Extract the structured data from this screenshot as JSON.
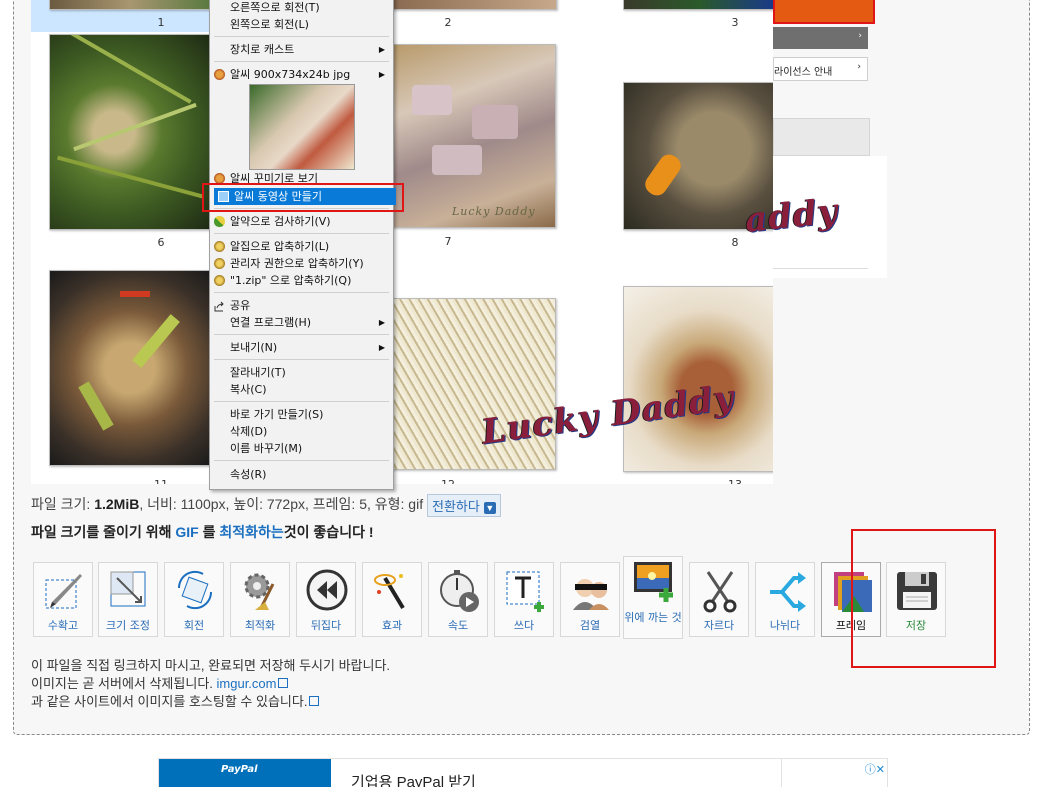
{
  "thumbnails": [
    {
      "label": "1"
    },
    {
      "label": "2"
    },
    {
      "label": "3"
    },
    {
      "label": "6"
    },
    {
      "label": "7"
    },
    {
      "label": "8"
    },
    {
      "label": "11"
    },
    {
      "label": "12"
    },
    {
      "label": "13"
    }
  ],
  "watermark_text": "Lucky Daddy",
  "right_panel": {
    "license_label": "라이선스 안내"
  },
  "context_menu": {
    "items": [
      {
        "label": "오른쪽으로 회전(T)"
      },
      {
        "label": "왼쪽으로 회전(L)"
      },
      {
        "label": "장치로 캐스트",
        "submenu": true
      },
      {
        "label": "알씨 900x734x24b jpg",
        "submenu": true
      },
      {
        "label": "알씨 꾸미기로 보기"
      },
      {
        "label": "알씨 동영상 만들기"
      },
      {
        "label": "알약으로 검사하기(V)"
      },
      {
        "label": "알집으로 압축하기(L)"
      },
      {
        "label": "관리자 권한으로 압축하기(Y)"
      },
      {
        "label": "\"1.zip\" 으로 압축하기(Q)"
      },
      {
        "label": "공유"
      },
      {
        "label": "연결 프로그램(H)",
        "submenu": true
      },
      {
        "label": "보내기(N)",
        "submenu": true
      },
      {
        "label": "잘라내기(T)"
      },
      {
        "label": "복사(C)"
      },
      {
        "label": "바로 가기 만들기(S)"
      },
      {
        "label": "삭제(D)"
      },
      {
        "label": "이름 바꾸기(M)"
      },
      {
        "label": "속성(R)"
      }
    ],
    "highlighted_index": 5
  },
  "file_info": {
    "size_prefix": "파일 크기:",
    "size_value": "1.2MiB",
    "rest": ", 너비: 1100px, 높이: 772px, 프레임: 5, 유형: gif",
    "convert_label": "전환하다"
  },
  "advice": {
    "part1": "파일 크기를 줄이기 위해",
    "gif": "GIF",
    "part2": "를",
    "optimize": "최적화하는",
    "part3": "것이 좋습니다 !"
  },
  "tools": [
    {
      "label": "수확고"
    },
    {
      "label": "크기 조정"
    },
    {
      "label": "회전"
    },
    {
      "label": "최적화"
    },
    {
      "label": "뒤집다"
    },
    {
      "label": "효과"
    },
    {
      "label": "속도"
    },
    {
      "label": "쓰다"
    },
    {
      "label": "검열"
    },
    {
      "label": "위에 까는 것"
    },
    {
      "label": "자르다"
    },
    {
      "label": "나뉘다"
    },
    {
      "label": "프레임"
    },
    {
      "label": "저장"
    }
  ],
  "notes": {
    "line1": "이 파일을 직접 링크하지 마시고, 완료되면 저장해 두시기 바랍니다.",
    "line2_prefix": "이미지는 곧 서버에서 삭제됩니다.",
    "line2_link": "imgur.com",
    "line3": "과 같은 사이트에서 이미지를 호스팅할 수 있습니다."
  },
  "ad": {
    "logo": "PayPal",
    "text": "기업용 PayPal 받기"
  },
  "colors": {
    "accent": "#1b6fc0",
    "highlight_red": "#e01616",
    "menu_highlight": "#0a7ad8"
  }
}
